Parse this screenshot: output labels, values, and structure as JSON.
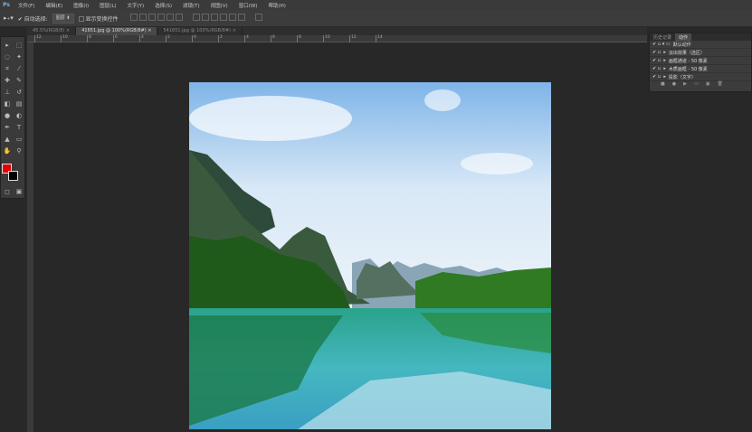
{
  "menu": [
    "文件(F)",
    "编辑(E)",
    "图像(I)",
    "图层(L)",
    "文字(Y)",
    "选择(S)",
    "滤镜(T)",
    "视图(V)",
    "窗口(W)",
    "帮助(H)"
  ],
  "logo": "Ps",
  "options": {
    "auto_select": "自动选择:",
    "layer_select": "图层",
    "show_transform": "显示变换控件"
  },
  "tabs": [
    {
      "label": "45.5%(RGB/8)",
      "close": "×"
    },
    {
      "label": "41651.jpg @ 100%(RGB/8#)",
      "close": "×"
    },
    {
      "label": "541651.jpg @ 100%(RGB/8#)",
      "close": "×"
    }
  ],
  "ruler": [
    "12",
    "10",
    "8",
    "6",
    "4",
    "2",
    "0",
    "2",
    "4",
    "6",
    "8",
    "10",
    "12",
    "14"
  ],
  "panel": {
    "tabs": [
      "历史记录",
      "动作"
    ],
    "items": [
      "默认动作",
      "淡出效果（选区）",
      "画框通道 - 50 像素",
      "木质画框 - 50 像素",
      "投影（文字）"
    ]
  },
  "colors": {
    "foreground": "#e00000",
    "background": "#000000"
  }
}
